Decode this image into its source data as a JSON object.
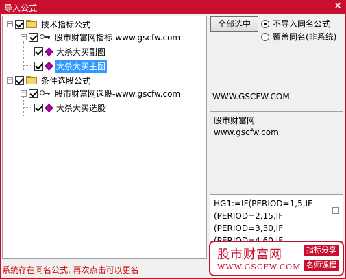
{
  "window": {
    "title": "导入公式",
    "close_glyph": "✕"
  },
  "tree": {
    "nodes": [
      {
        "label": "技术指标公式",
        "kind": "folder",
        "checked": true
      },
      {
        "label": "股市财富网指标-www.gscfw.com",
        "kind": "key",
        "checked": true
      },
      {
        "label": "大杀大买副图",
        "kind": "formula",
        "checked": true
      },
      {
        "label": "大杀大买主图",
        "kind": "formula",
        "checked": true,
        "selected": true
      },
      {
        "label": "条件选股公式",
        "kind": "folder",
        "checked": true
      },
      {
        "label": "股市财富网选股-www.gscfw.com",
        "kind": "key",
        "checked": true
      },
      {
        "label": "大杀大买选股",
        "kind": "formula",
        "checked": true
      }
    ]
  },
  "controls": {
    "select_all_label": "全部选中",
    "radio_skip_label": "不导入同名公式",
    "radio_overwrite_label": "覆盖同名(非系统)",
    "radio_selected": "skip"
  },
  "info": {
    "url": "WWW.GSCFW.COM",
    "desc_line1": "股市财富网",
    "desc_line2": "www.gscfw.com",
    "code_lines": [
      "HG1:=IF(PERIOD=1,5,IF",
      "(PERIOD=2,15,IF",
      "(PERIOD=3,30,IF",
      "(PERIOD=4,60,IF"
    ]
  },
  "status": {
    "message": "系统存在同名公式, 再次点击可以更名"
  },
  "logo": {
    "name": "股市财富网",
    "site": "WWW.GSCFW.COM",
    "tag1": "指标分享",
    "tag2": "名师课程",
    "color": "#c8102e"
  }
}
